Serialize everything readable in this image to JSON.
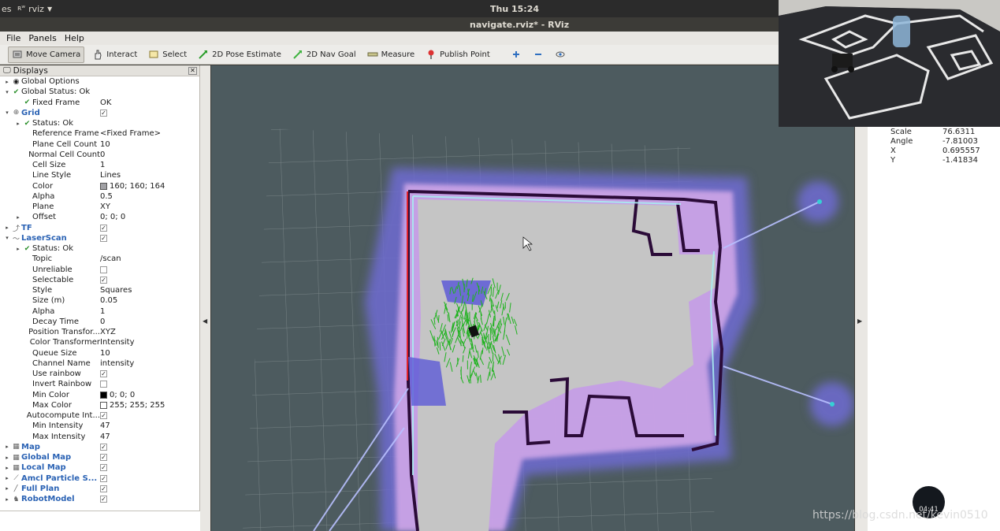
{
  "topbar": {
    "activities": "es",
    "app_name": "rviz",
    "clock": "Thu 15:24"
  },
  "window_title": "navigate.rviz* - RViz",
  "menu": [
    "File",
    "Panels",
    "Help"
  ],
  "toolbar": {
    "move_camera": "Move Camera",
    "interact": "Interact",
    "select": "Select",
    "pose_estimate": "2D Pose Estimate",
    "nav_goal": "2D Nav Goal",
    "measure": "Measure",
    "publish_point": "Publish Point"
  },
  "displays": {
    "title": "Displays",
    "rows": [
      {
        "d": 0,
        "arrow": "▸",
        "icon": "◉",
        "label": "Global Options",
        "value": "",
        "bold": false
      },
      {
        "d": 0,
        "arrow": "▾",
        "icon": "✔",
        "label": "Global Status: Ok",
        "value": "",
        "bold": false
      },
      {
        "d": 1,
        "arrow": "",
        "icon": "✔",
        "label": "Fixed Frame",
        "value": "OK",
        "bold": false
      },
      {
        "d": 0,
        "arrow": "▾",
        "icon": "⊕",
        "label": "Grid",
        "value": "✓",
        "chk": true,
        "bold": true
      },
      {
        "d": 1,
        "arrow": "▸",
        "icon": "✔",
        "label": "Status: Ok",
        "value": "",
        "bold": false
      },
      {
        "d": 1,
        "arrow": "",
        "icon": "",
        "label": "Reference Frame",
        "value": "<Fixed Frame>",
        "bold": false
      },
      {
        "d": 1,
        "arrow": "",
        "icon": "",
        "label": "Plane Cell Count",
        "value": "10",
        "bold": false
      },
      {
        "d": 1,
        "arrow": "",
        "icon": "",
        "label": "Normal Cell Count",
        "value": "0",
        "bold": false
      },
      {
        "d": 1,
        "arrow": "",
        "icon": "",
        "label": "Cell Size",
        "value": "1",
        "bold": false
      },
      {
        "d": 1,
        "arrow": "",
        "icon": "",
        "label": "Line Style",
        "value": "Lines",
        "bold": false
      },
      {
        "d": 1,
        "arrow": "",
        "icon": "",
        "label": "Color",
        "value": "160; 160; 164",
        "swatch": "#a0a0a4",
        "bold": false
      },
      {
        "d": 1,
        "arrow": "",
        "icon": "",
        "label": "Alpha",
        "value": "0.5",
        "bold": false
      },
      {
        "d": 1,
        "arrow": "",
        "icon": "",
        "label": "Plane",
        "value": "XY",
        "bold": false
      },
      {
        "d": 1,
        "arrow": "▸",
        "icon": "",
        "label": "Offset",
        "value": "0; 0; 0",
        "bold": false
      },
      {
        "d": 0,
        "arrow": "▸",
        "icon": "⤴",
        "label": "TF",
        "value": "✓",
        "chk": true,
        "bold": true
      },
      {
        "d": 0,
        "arrow": "▾",
        "icon": "〜",
        "label": "LaserScan",
        "value": "✓",
        "chk": true,
        "bold": true
      },
      {
        "d": 1,
        "arrow": "▸",
        "icon": "✔",
        "label": "Status: Ok",
        "value": "",
        "bold": false
      },
      {
        "d": 1,
        "arrow": "",
        "icon": "",
        "label": "Topic",
        "value": "/scan",
        "bold": false
      },
      {
        "d": 1,
        "arrow": "",
        "icon": "",
        "label": "Unreliable",
        "value": "",
        "chk": true,
        "bold": false
      },
      {
        "d": 1,
        "arrow": "",
        "icon": "",
        "label": "Selectable",
        "value": "✓",
        "chk": true,
        "bold": false
      },
      {
        "d": 1,
        "arrow": "",
        "icon": "",
        "label": "Style",
        "value": "Squares",
        "bold": false
      },
      {
        "d": 1,
        "arrow": "",
        "icon": "",
        "label": "Size (m)",
        "value": "0.05",
        "bold": false
      },
      {
        "d": 1,
        "arrow": "",
        "icon": "",
        "label": "Alpha",
        "value": "1",
        "bold": false
      },
      {
        "d": 1,
        "arrow": "",
        "icon": "",
        "label": "Decay Time",
        "value": "0",
        "bold": false
      },
      {
        "d": 1,
        "arrow": "",
        "icon": "",
        "label": "Position Transfor...",
        "value": "XYZ",
        "bold": false
      },
      {
        "d": 1,
        "arrow": "",
        "icon": "",
        "label": "Color Transformer",
        "value": "Intensity",
        "bold": false
      },
      {
        "d": 1,
        "arrow": "",
        "icon": "",
        "label": "Queue Size",
        "value": "10",
        "bold": false
      },
      {
        "d": 1,
        "arrow": "",
        "icon": "",
        "label": "Channel Name",
        "value": "intensity",
        "bold": false
      },
      {
        "d": 1,
        "arrow": "",
        "icon": "",
        "label": "Use rainbow",
        "value": "✓",
        "chk": true,
        "bold": false
      },
      {
        "d": 1,
        "arrow": "",
        "icon": "",
        "label": "Invert Rainbow",
        "value": "",
        "chk": true,
        "bold": false
      },
      {
        "d": 1,
        "arrow": "",
        "icon": "",
        "label": "Min Color",
        "value": "0; 0; 0",
        "swatch": "#000000",
        "bold": false
      },
      {
        "d": 1,
        "arrow": "",
        "icon": "",
        "label": "Max Color",
        "value": "255; 255; 255",
        "swatch": "#ffffff",
        "bold": false
      },
      {
        "d": 1,
        "arrow": "",
        "icon": "",
        "label": "Autocompute Int...",
        "value": "✓",
        "chk": true,
        "bold": false
      },
      {
        "d": 1,
        "arrow": "",
        "icon": "",
        "label": "Min Intensity",
        "value": "47",
        "bold": false
      },
      {
        "d": 1,
        "arrow": "",
        "icon": "",
        "label": "Max Intensity",
        "value": "47",
        "bold": false
      },
      {
        "d": 0,
        "arrow": "▸",
        "icon": "▦",
        "label": "Map",
        "value": "✓",
        "chk": true,
        "bold": true
      },
      {
        "d": 0,
        "arrow": "▸",
        "icon": "▦",
        "label": "Global Map",
        "value": "✓",
        "chk": true,
        "bold": true
      },
      {
        "d": 0,
        "arrow": "▸",
        "icon": "▦",
        "label": "Local Map",
        "value": "✓",
        "chk": true,
        "bold": true
      },
      {
        "d": 0,
        "arrow": "▸",
        "icon": "⟋",
        "label": "Amcl Particle S...",
        "value": "✓",
        "chk": true,
        "bold": true
      },
      {
        "d": 0,
        "arrow": "▸",
        "icon": "╱",
        "label": "Full Plan",
        "value": "✓",
        "chk": true,
        "bold": true
      },
      {
        "d": 0,
        "arrow": "▸",
        "icon": "♞",
        "label": "RobotModel",
        "value": "✓",
        "chk": true,
        "bold": true
      }
    ]
  },
  "view_props": {
    "rows": [
      {
        "k": "Scale",
        "v": "76.6311"
      },
      {
        "k": "Angle",
        "v": "-7.81003"
      },
      {
        "k": "X",
        "v": "0.695557"
      },
      {
        "k": "Y",
        "v": "-1.41834"
      }
    ]
  },
  "timer": "04:41",
  "watermark": "https://blog.csdn.net/kevin0510",
  "colors": {
    "background": "#4d5b5f",
    "costmap_inflation": "#8b7fd1",
    "costmap_lethal": "#c8f4f8",
    "free_space": "#c8c8c8",
    "wall": "#2a0a3a",
    "particles": "#22b322"
  }
}
